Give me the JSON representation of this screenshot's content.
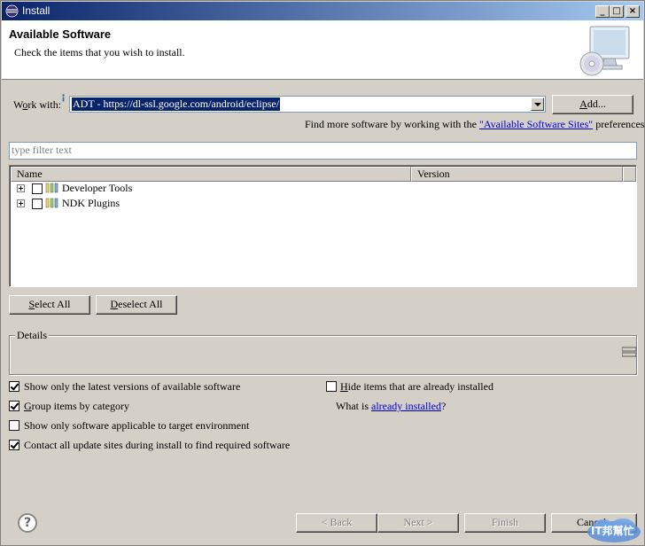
{
  "window": {
    "title": "Install",
    "minimize_glyph": "_",
    "maximize_glyph": "□",
    "close_glyph": "×"
  },
  "header": {
    "title": "Available Software",
    "description": "Check the items that you wish to install."
  },
  "work_with": {
    "label_prefix": "W",
    "label_underlined": "o",
    "label_suffix": "rk with:",
    "value": "ADT - https://dl-ssl.google.com/android/eclipse/",
    "add_button_underlined": "A",
    "add_button_rest": "dd..."
  },
  "more_software": {
    "prefix": "Find more software by working with the",
    "link": "\"Available Software Sites\"",
    "suffix": "preferences."
  },
  "filter": {
    "placeholder": "type filter text"
  },
  "table": {
    "columns": [
      "Name",
      "Version"
    ],
    "rows": [
      {
        "label": "Developer Tools"
      },
      {
        "label": "NDK Plugins"
      }
    ]
  },
  "selection_buttons": {
    "select_all_underlined": "S",
    "select_all_rest": "elect All",
    "deselect_all_underlined": "D",
    "deselect_all_rest": "eselect All"
  },
  "details": {
    "legend": "Details"
  },
  "options": {
    "latest_versions": {
      "underlined": "",
      "text": "Show only the latest versions of available software",
      "checked": true
    },
    "group_by_category": {
      "underlined": "G",
      "text": "roup items by category",
      "checked": true
    },
    "target_env": {
      "underlined": "",
      "text": "Show only software applicable to target environment",
      "checked": false
    },
    "contact_sites": {
      "underlined": "",
      "text": "Contact all update sites during install to find required software",
      "checked": true
    },
    "hide_installed": {
      "underlined": "H",
      "text": "ide items that are already installed",
      "checked": false
    },
    "what_is_prefix": "What is",
    "what_is_link": "already installed",
    "what_is_suffix": "?"
  },
  "footer": {
    "help_glyph": "?",
    "back": "< Back",
    "next": "Next >",
    "finish": "Finish",
    "cancel": "Cancel",
    "watermark_text": "IT邦幫忙"
  },
  "colors": {
    "titlebar_start": "#0a246a",
    "titlebar_end": "#a6caf0",
    "selection": "#0a246a",
    "link": "#0000cc",
    "dialog_bg": "#d4d0c8"
  }
}
